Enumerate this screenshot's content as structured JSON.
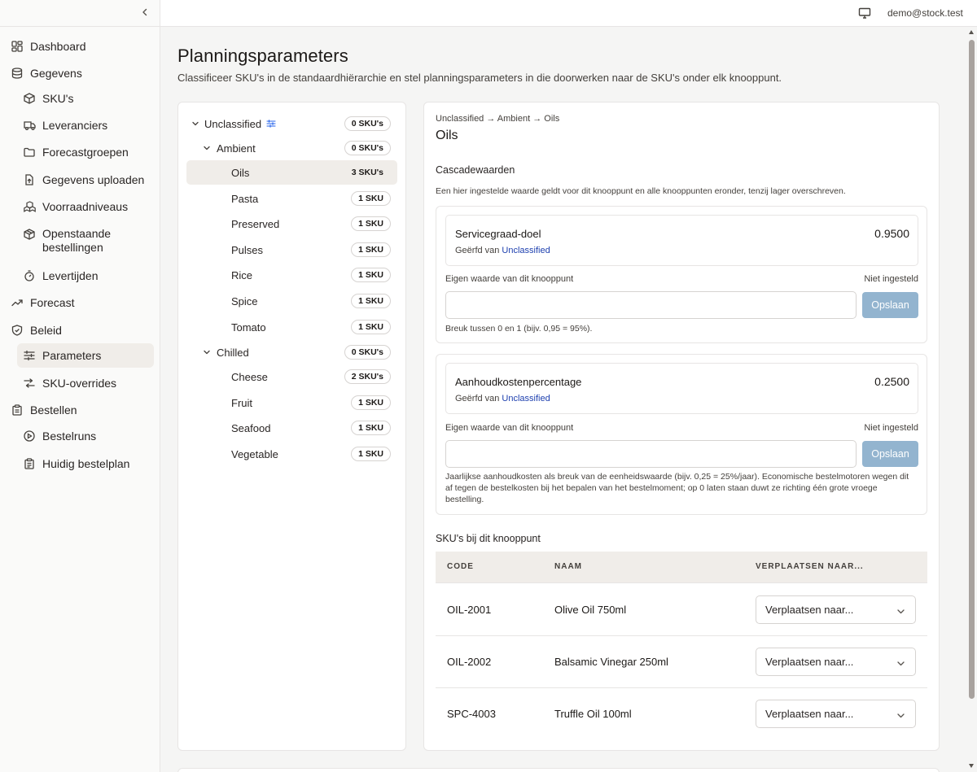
{
  "sidebar": {
    "items": [
      {
        "label": "Dashboard",
        "icon": "dashboard-icon"
      },
      {
        "label": "Gegevens",
        "icon": "database-icon"
      },
      {
        "label": "SKU's",
        "icon": "box-icon"
      },
      {
        "label": "Leveranciers",
        "icon": "truck-icon"
      },
      {
        "label": "Forecastgroepen",
        "icon": "folder-icon"
      },
      {
        "label": "Gegevens uploaden",
        "icon": "upload-file-icon"
      },
      {
        "label": "Voorraadniveaus",
        "icon": "boxes-icon"
      },
      {
        "label": "Openstaande",
        "label2": "bestellingen",
        "icon": "package-icon"
      },
      {
        "label": "Levertijden",
        "icon": "timer-icon"
      },
      {
        "label": "Forecast",
        "icon": "trend-icon"
      },
      {
        "label": "Beleid",
        "icon": "shield-icon"
      },
      {
        "label": "Parameters",
        "icon": "sliders-icon"
      },
      {
        "label": "SKU-overrides",
        "icon": "shuffle-icon"
      },
      {
        "label": "Bestellen",
        "icon": "clipboard-icon"
      },
      {
        "label": "Bestelruns",
        "icon": "play-circle-icon"
      },
      {
        "label": "Huidig bestelplan",
        "icon": "clipboard-list-icon"
      }
    ]
  },
  "topbar": {
    "user_email": "demo@stock.test"
  },
  "page": {
    "title": "Planningsparameters",
    "subtitle": "Classificeer SKU's in de standaardhiërarchie en stel planningsparameters in die doorwerken naar de SKU's onder elk knooppunt."
  },
  "tree": [
    {
      "label": "Unclassified",
      "badge": "0 SKU's"
    },
    {
      "label": "Ambient",
      "badge": "0 SKU's"
    },
    {
      "label": "Oils",
      "badge": "3 SKU's"
    },
    {
      "label": "Pasta",
      "badge": "1 SKU"
    },
    {
      "label": "Preserved",
      "badge": "1 SKU"
    },
    {
      "label": "Pulses",
      "badge": "1 SKU"
    },
    {
      "label": "Rice",
      "badge": "1 SKU"
    },
    {
      "label": "Spice",
      "badge": "1 SKU"
    },
    {
      "label": "Tomato",
      "badge": "1 SKU"
    },
    {
      "label": "Chilled",
      "badge": "0 SKU's"
    },
    {
      "label": "Cheese",
      "badge": "2 SKU's"
    },
    {
      "label": "Fruit",
      "badge": "1 SKU"
    },
    {
      "label": "Seafood",
      "badge": "1 SKU"
    },
    {
      "label": "Vegetable",
      "badge": "1 SKU"
    }
  ],
  "detail": {
    "breadcrumb": "Unclassified → Ambient → Oils",
    "title": "Oils",
    "cascade_title": "Cascadewaarden",
    "cascade_desc": "Een hier ingestelde waarde geldt voor dit knooppunt en alle knooppunten eronder, tenzij lager overschreven.",
    "params": [
      {
        "name": "Servicegraad-doel",
        "value": "0.9500",
        "inherited_prefix": "Geërfd van",
        "inherited_link": "Unclassified",
        "own_label": "Eigen waarde van dit knooppunt",
        "own_state": "Niet ingesteld",
        "input_value": "",
        "save_label": "Opslaan",
        "hint": "Breuk tussen 0 en 1 (bijv. 0,95 = 95%)."
      },
      {
        "name": "Aanhoudkostenpercentage",
        "value": "0.2500",
        "inherited_prefix": "Geërfd van",
        "inherited_link": "Unclassified",
        "own_label": "Eigen waarde van dit knooppunt",
        "own_state": "Niet ingesteld",
        "input_value": "",
        "save_label": "Opslaan",
        "hint": "Jaarlijkse aanhoudkosten als breuk van de eenheidswaarde (bijv. 0,25 = 25%/jaar). Economische bestelmotoren wegen dit af tegen de bestelkosten bij het bepalen van het bestelmoment; op 0 laten staan duwt ze richting één grote vroege bestelling."
      }
    ],
    "skus_title": "SKU's bij dit knooppunt",
    "table": {
      "headers": [
        "CODE",
        "NAAM",
        "VERPLAATSEN NAAR..."
      ],
      "rows": [
        {
          "code": "OIL-2001",
          "name": "Olive Oil 750ml",
          "move": "Verplaatsen naar..."
        },
        {
          "code": "OIL-2002",
          "name": "Balsamic Vinegar 250ml",
          "move": "Verplaatsen naar..."
        },
        {
          "code": "SPC-4003",
          "name": "Truffle Oil 100ml",
          "move": "Verplaatsen naar..."
        }
      ]
    }
  },
  "colors": {
    "accent_link": "#1e40af",
    "save_button": "#93b4cf",
    "active_nav": "#f0ede9"
  }
}
